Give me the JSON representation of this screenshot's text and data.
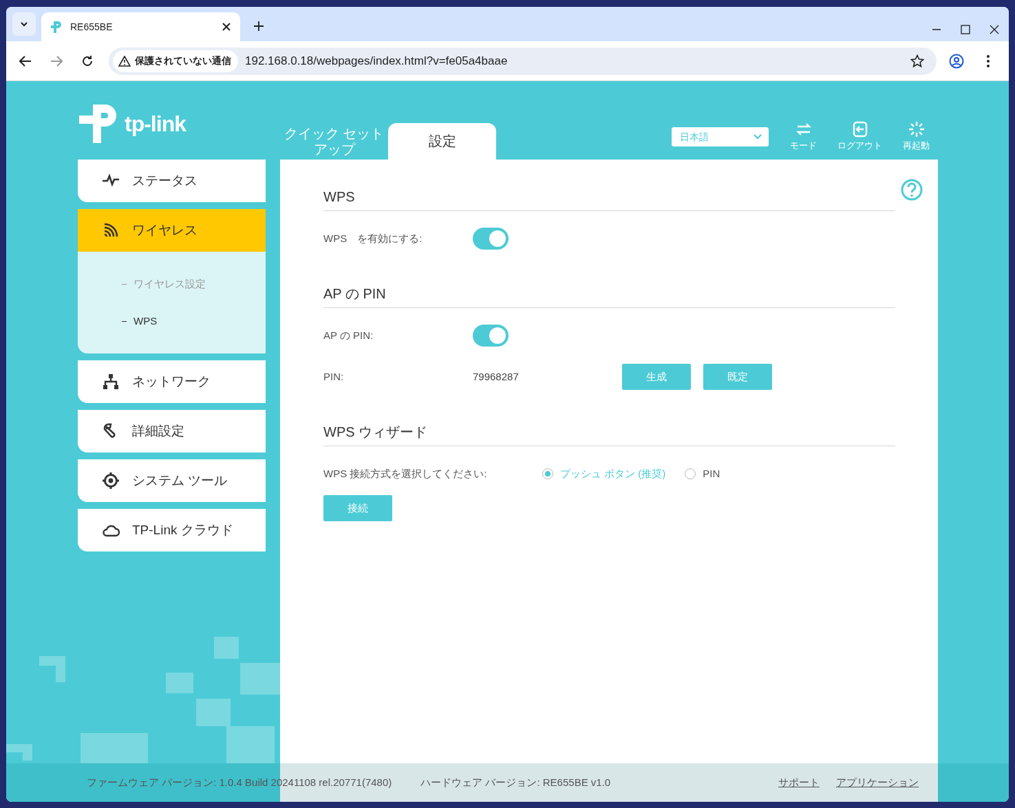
{
  "browser": {
    "tab_title": "RE655BE",
    "security_label": "保護されていない通信",
    "url": "192.168.0.18/webpages/index.html?v=fe05a4baae"
  },
  "header": {
    "logo_text": "tp-link",
    "nav_tabs": [
      {
        "label": "クイック セットアップ",
        "selected": false
      },
      {
        "label": "設定",
        "selected": true
      }
    ],
    "language": {
      "value": "日本語"
    },
    "actions": [
      {
        "kind": "mode",
        "label": "モード"
      },
      {
        "kind": "logout",
        "label": "ログアウト"
      },
      {
        "kind": "reboot",
        "label": "再起動"
      }
    ]
  },
  "sidebar": {
    "items": [
      {
        "kind": "status",
        "label": "ステータス",
        "selected": false
      },
      {
        "kind": "wireless",
        "label": "ワイヤレス",
        "selected": true,
        "expanded": true,
        "children": [
          {
            "label": "ワイヤレス設定",
            "selected": false
          },
          {
            "label": "WPS",
            "selected": true
          }
        ]
      },
      {
        "kind": "network",
        "label": "ネットワーク",
        "selected": false
      },
      {
        "kind": "advanced",
        "label": "詳細設定",
        "selected": false
      },
      {
        "kind": "system",
        "label": "システム ツール",
        "selected": false
      },
      {
        "kind": "cloud",
        "label": "TP-Link クラウド",
        "selected": false
      }
    ]
  },
  "content": {
    "sections": [
      {
        "title": "WPS",
        "rows": [
          {
            "kind": "toggle",
            "label": "WPS　を有効にする:",
            "on": true
          }
        ]
      },
      {
        "title": "AP の PIN",
        "rows": [
          {
            "kind": "toggle",
            "label": "AP の PIN:",
            "on": true
          },
          {
            "kind": "value",
            "label": "PIN:",
            "value": "79968287",
            "buttons": [
              "生成",
              "既定"
            ]
          }
        ]
      },
      {
        "title": "WPS ウィザード",
        "rows": [
          {
            "kind": "radio",
            "label": "WPS 接続方式を選択してください:",
            "options": [
              {
                "label": "プッシュ ボタン (推奨)",
                "selected": true
              },
              {
                "label": "PIN",
                "selected": false
              }
            ]
          },
          {
            "kind": "button",
            "label": "接続"
          }
        ]
      }
    ]
  },
  "footer": {
    "firmware": "ファームウェア バージョン: 1.0.4 Build 20241108 rel.20771(7480)",
    "hardware": "ハードウェア バージョン: RE655BE v1.0",
    "links": [
      "サポート",
      "アプリケーション"
    ]
  }
}
